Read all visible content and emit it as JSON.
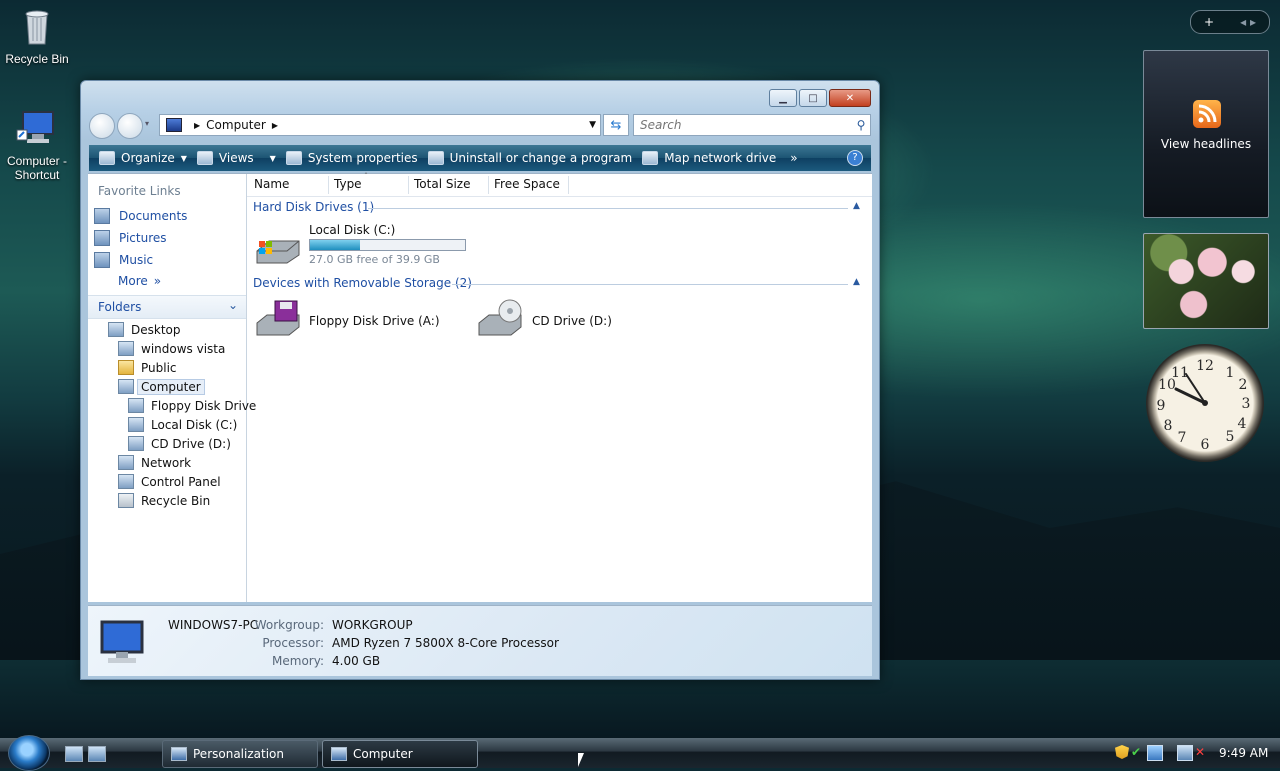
{
  "desktop": {
    "icons": [
      {
        "label": "Recycle Bin",
        "icon": "recycle-bin-icon"
      },
      {
        "label": "Computer - Shortcut",
        "icon": "computer-icon"
      }
    ]
  },
  "window": {
    "address": "Computer",
    "search_placeholder": "Search",
    "toolbar": {
      "organize": "Organize",
      "views": "Views",
      "system_properties": "System properties",
      "uninstall": "Uninstall or change a program",
      "map_drive": "Map network drive",
      "more": "»",
      "help": "?"
    },
    "left_pane": {
      "favorite_links_title": "Favorite Links",
      "links": [
        "Documents",
        "Pictures",
        "Music",
        "More"
      ],
      "more_glyph": "»",
      "folders_title": "Folders",
      "tree": [
        {
          "label": "Desktop",
          "level": 0
        },
        {
          "label": "windows vista",
          "level": 1
        },
        {
          "label": "Public",
          "level": 1
        },
        {
          "label": "Computer",
          "level": 1,
          "selected": true
        },
        {
          "label": "Floppy Disk Drive",
          "level": 2
        },
        {
          "label": "Local Disk (C:)",
          "level": 2
        },
        {
          "label": "CD Drive (D:)",
          "level": 2
        },
        {
          "label": "Network",
          "level": 1
        },
        {
          "label": "Control Panel",
          "level": 1
        },
        {
          "label": "Recycle Bin",
          "level": 1
        }
      ]
    },
    "columns": [
      "Name",
      "Type",
      "Total Size",
      "Free Space"
    ],
    "groups": {
      "hdd": {
        "title": "Hard Disk Drives (1)",
        "items": [
          {
            "label": "Local Disk (C:)",
            "sub": "27.0 GB free of 39.9 GB",
            "used_fraction": 0.32
          }
        ]
      },
      "removable": {
        "title": "Devices with Removable Storage (2)",
        "items": [
          {
            "label": "Floppy Disk Drive (A:)"
          },
          {
            "label": "CD Drive (D:)"
          }
        ]
      }
    },
    "details": {
      "computer_name": "WINDOWS7-PC",
      "workgroup_label": "Workgroup:",
      "workgroup": "WORKGROUP",
      "processor_label": "Processor:",
      "processor": "AMD Ryzen 7 5800X 8-Core Processor",
      "memory_label": "Memory:",
      "memory": "4.00 GB"
    }
  },
  "sidebar": {
    "add_button": "+",
    "nav_glyphs": "◂ ▸",
    "feed_label": "View headlines"
  },
  "taskbar": {
    "tasks": [
      "Personalization",
      "Computer"
    ],
    "time": "9:49 AM"
  }
}
